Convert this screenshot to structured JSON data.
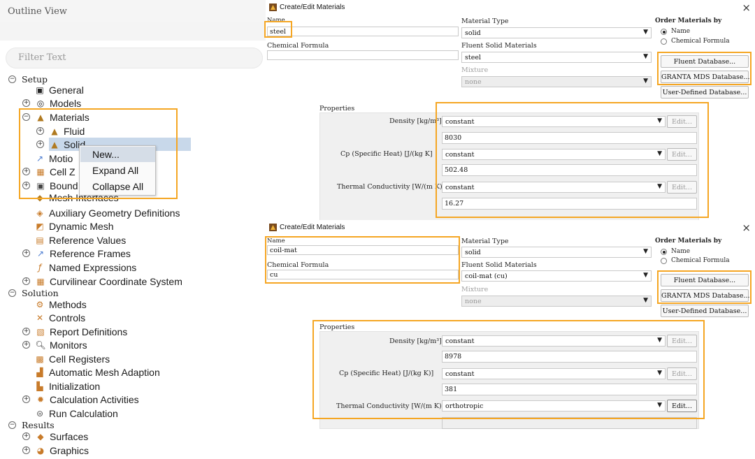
{
  "outline": {
    "title": "Outline View",
    "filter_placeholder": "Filter Text",
    "tree": {
      "setup": "Setup",
      "general": "General",
      "models": "Models",
      "materials": "Materials",
      "fluid": "Fluid",
      "solid": "Solid",
      "motion": "Motio",
      "cell_zones": "Cell Z",
      "boundary": "Bound",
      "mesh_interfaces": "Mesh Interfaces",
      "aux_geom": "Auxiliary Geometry Definitions",
      "dynamic_mesh": "Dynamic Mesh",
      "reference_values": "Reference Values",
      "reference_frames": "Reference Frames",
      "named_expressions": "Named Expressions",
      "curvilinear": "Curvilinear Coordinate System",
      "solution": "Solution",
      "methods": "Methods",
      "controls": "Controls",
      "report_definitions": "Report Definitions",
      "monitors": "Monitors",
      "cell_registers": "Cell Registers",
      "auto_mesh": "Automatic Mesh Adaption",
      "initialization": "Initialization",
      "calc_activities": "Calculation Activities",
      "run_calc": "Run Calculation",
      "results": "Results",
      "surfaces": "Surfaces",
      "graphics": "Graphics"
    },
    "context_menu": [
      "New...",
      "Expand All",
      "Collapse All"
    ]
  },
  "dialog_common": {
    "title": "Create/Edit Materials",
    "close": "×",
    "name_label": "Name",
    "chem_label": "Chemical Formula",
    "material_type_label": "Material Type",
    "fluent_solid_label": "Fluent Solid Materials",
    "mixture_label": "Mixture",
    "mixture_value": "none",
    "order_by_label": "Order Materials by",
    "order_name": "Name",
    "order_chem": "Chemical Formula",
    "fluent_db": "Fluent Database...",
    "granta_db": "GRANTA MDS Database...",
    "user_db": "User-Defined Database...",
    "properties_label": "Properties",
    "density_label": "Density [kg/m³]",
    "cp_label_1": "Cp (Specific Heat) [J/(kg K]",
    "cp_label_2": "Cp (Specific Heat) [J/(kg K)]",
    "tc_label_1": "Thermal Conductivity [W/(m K)",
    "tc_label_2": "Thermal Conductivity [W/(m K)]",
    "edit": "Edit..."
  },
  "dialog1": {
    "name": "steel",
    "chem": "",
    "material_type": "solid",
    "fluent_solid": "steel",
    "density_method": "constant",
    "density_value": "8030",
    "cp_method": "constant",
    "cp_value": "502.48",
    "tc_method": "constant",
    "tc_value": "16.27"
  },
  "dialog2": {
    "name": "coil-mat",
    "chem": "cu",
    "material_type": "solid",
    "fluent_solid": "coil-mat (cu)",
    "density_method": "constant",
    "density_value": "8978",
    "cp_method": "constant",
    "cp_value": "381",
    "tc_method": "orthotropic",
    "tc_value": ""
  },
  "colors": {
    "highlight": "#f5a623",
    "selection": "#c8d8ea"
  }
}
